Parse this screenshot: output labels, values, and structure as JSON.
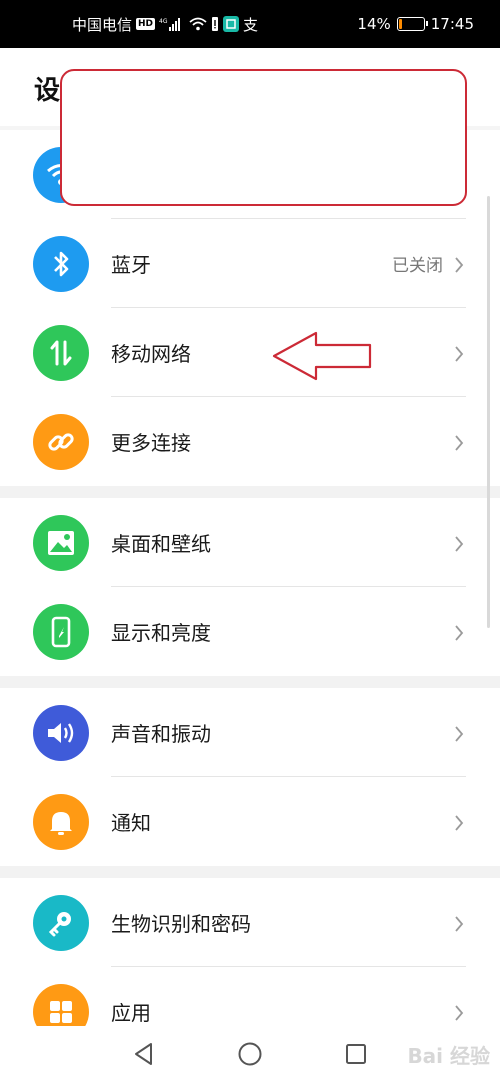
{
  "status_bar": {
    "carrier": "中国电信",
    "hd_badge": "HD",
    "network": "4G",
    "battery_percent": "14%",
    "battery_level": 0.14,
    "time": "17:45",
    "notif_app": "支"
  },
  "header": {
    "title": "设"
  },
  "settings": [
    {
      "id": "wlan",
      "label": "",
      "value": "",
      "icon": "wifi-icon",
      "color": "#1e9bf0"
    },
    {
      "id": "bluetooth",
      "label": "蓝牙",
      "value": "已关闭",
      "icon": "bluetooth-icon",
      "color": "#1e9bf0"
    },
    {
      "id": "mobile-network",
      "label": "移动网络",
      "value": "",
      "icon": "mobile-data-icon",
      "color": "#2fc75a"
    },
    {
      "id": "more-connections",
      "label": "更多连接",
      "value": "",
      "icon": "link-icon",
      "color": "#ff9a14"
    },
    {
      "id": "home-wallpaper",
      "label": "桌面和壁纸",
      "value": "",
      "icon": "image-icon",
      "color": "#2fc75a"
    },
    {
      "id": "display-brightness",
      "label": "显示和亮度",
      "value": "",
      "icon": "phone-brightness-icon",
      "color": "#2fc75a"
    },
    {
      "id": "sound-vibration",
      "label": "声音和振动",
      "value": "",
      "icon": "speaker-icon",
      "color": "#3f5bd9"
    },
    {
      "id": "notifications",
      "label": "通知",
      "value": "",
      "icon": "bell-icon",
      "color": "#ff9a14"
    },
    {
      "id": "biometrics-password",
      "label": "生物识别和密码",
      "value": "",
      "icon": "key-icon",
      "color": "#19b9c7"
    },
    {
      "id": "apps",
      "label": "应用",
      "value": "",
      "icon": "apps-grid-icon",
      "color": "#ff9a14"
    }
  ],
  "nav_bar": {
    "back": "back-icon",
    "home": "home-icon",
    "recents": "recents-icon"
  },
  "watermark": {
    "text": "Bai 经验"
  },
  "colors": {
    "annotation_red": "#cc2a36",
    "accent_blue": "#1e9bf0",
    "accent_green": "#2fc75a",
    "accent_orange": "#ff9a14"
  }
}
